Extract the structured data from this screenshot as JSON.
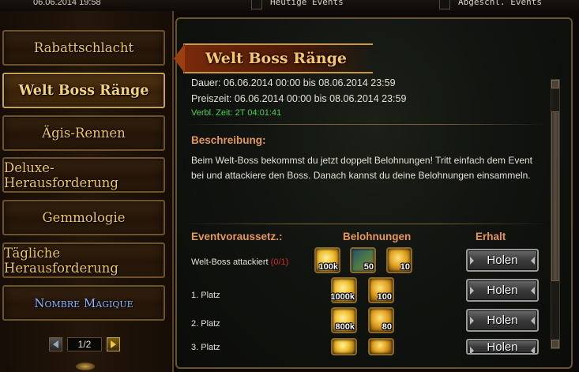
{
  "top": {
    "datetime": "06.06.2014 19:58",
    "checkbox1_label": "Heutige Events",
    "checkbox2_label": "Abgeschl. Events"
  },
  "sidebar": {
    "items": [
      {
        "label": "Rabattschlacht",
        "active": false
      },
      {
        "label": "Welt Boss Ränge",
        "active": true
      },
      {
        "label": "Ägis-Rennen",
        "active": false
      },
      {
        "label": "Deluxe-Herausforderung",
        "active": false
      },
      {
        "label": "Gemmologie",
        "active": false
      },
      {
        "label": "Tägliche Herausforderung",
        "active": false
      },
      {
        "label": "Nombre Magique",
        "active": false
      }
    ],
    "pager": {
      "current": "1/2"
    }
  },
  "panel": {
    "title": "Welt Boss Ränge",
    "dauer": "Dauer: 06.06.2014 00:00 bis 08.06.2014 23:59",
    "preiszeit": "Preiszeit: 06.06.2014 00:00 bis 08.06.2014 23:59",
    "verbl": "Verbl. Zeit: 2T 04:01:41",
    "beschreibung_heading": "Beschreibung:",
    "beschreibung_text": "Beim Welt-Boss bekommst du jetzt doppelt Belohnungen! Tritt einfach dem Event bei und attackiere den Boss. Danach kannst du deine Belohnungen einsammeln.",
    "col_eventvoraussetz": "Eventvoraussetz.:",
    "col_belohnungen": "Belohnungen",
    "col_erhalt": "Erhalt",
    "rows": [
      {
        "label": "Welt-Boss attackiert ",
        "progress": "(0/1)",
        "rewards": [
          "100k",
          "50",
          "10"
        ],
        "button": "Holen"
      },
      {
        "label": "1. Platz",
        "progress": "",
        "rewards": [
          "1000k",
          "100"
        ],
        "button": "Holen"
      },
      {
        "label": "2. Platz",
        "progress": "",
        "rewards": [
          "800k",
          "80"
        ],
        "button": "Holen"
      },
      {
        "label": "3. Platz",
        "progress": "",
        "rewards": [
          "",
          ""
        ],
        "button": "Holen"
      }
    ]
  },
  "colors": {
    "heading_orange": "#e49758",
    "timer_green": "#4cd04a",
    "progress_red": "#d02a20",
    "nav_gold": "#f0c65a"
  }
}
